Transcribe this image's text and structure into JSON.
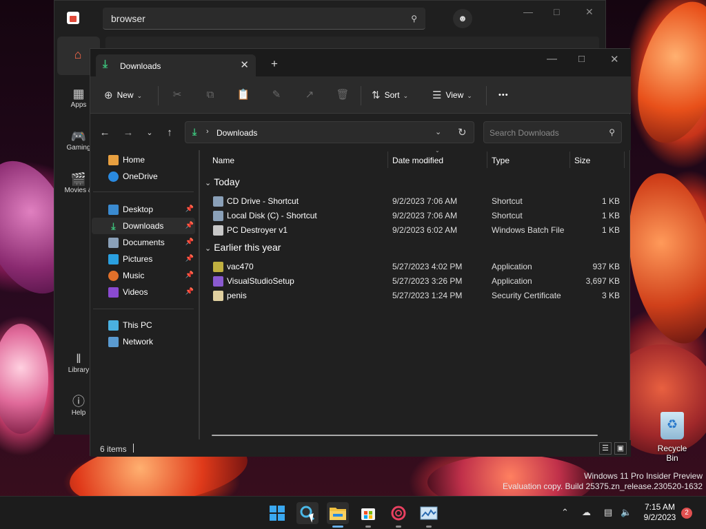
{
  "store": {
    "search_value": "browser",
    "nav": [
      {
        "label": "Apps",
        "icon": "apps-icon"
      },
      {
        "label": "Gaming",
        "icon": "gaming-icon"
      },
      {
        "label": "Movies &",
        "icon": "movies-icon"
      },
      {
        "label": "Library",
        "icon": "library-icon"
      },
      {
        "label": "Help",
        "icon": "help-icon"
      }
    ]
  },
  "explorer": {
    "tab_title": "Downloads",
    "toolbar": {
      "new_label": "New",
      "sort_label": "Sort",
      "view_label": "View",
      "more_label": "•••"
    },
    "address": {
      "path": "Downloads",
      "search_placeholder": "Search Downloads"
    },
    "nav_pane": {
      "group1": [
        "Home",
        "OneDrive"
      ],
      "quick_access": [
        "Desktop",
        "Downloads",
        "Documents",
        "Pictures",
        "Music",
        "Videos"
      ],
      "group3": [
        "This PC",
        "Network"
      ],
      "selected": "Downloads"
    },
    "columns": [
      "Name",
      "Date modified",
      "Type",
      "Size"
    ],
    "groups": [
      {
        "label": "Today",
        "files": [
          {
            "name": "CD Drive - Shortcut",
            "date": "9/2/2023 7:06 AM",
            "type": "Shortcut",
            "size": "1 KB"
          },
          {
            "name": "Local Disk (C) - Shortcut",
            "date": "9/2/2023 7:06 AM",
            "type": "Shortcut",
            "size": "1 KB"
          },
          {
            "name": "PC Destroyer v1",
            "date": "9/2/2023 6:02 AM",
            "type": "Windows Batch File",
            "size": "1 KB"
          }
        ]
      },
      {
        "label": "Earlier this year",
        "files": [
          {
            "name": "vac470",
            "date": "5/27/2023 4:02 PM",
            "type": "Application",
            "size": "937 KB"
          },
          {
            "name": "VisualStudioSetup",
            "date": "5/27/2023 3:26 PM",
            "type": "Application",
            "size": "3,697 KB"
          },
          {
            "name": "penis",
            "date": "5/27/2023 1:24 PM",
            "type": "Security Certificate",
            "size": "3 KB"
          }
        ]
      }
    ],
    "status": "6 items"
  },
  "desktop": {
    "recycle_bin": "Recycle Bin",
    "watermark_line1": "Windows 11 Pro Insider Preview",
    "watermark_line2": "Evaluation copy. Build 25375.zn_release.230520-1632"
  },
  "taskbar": {
    "time": "7:15 AM",
    "date": "9/2/2023",
    "notification_count": "2"
  }
}
